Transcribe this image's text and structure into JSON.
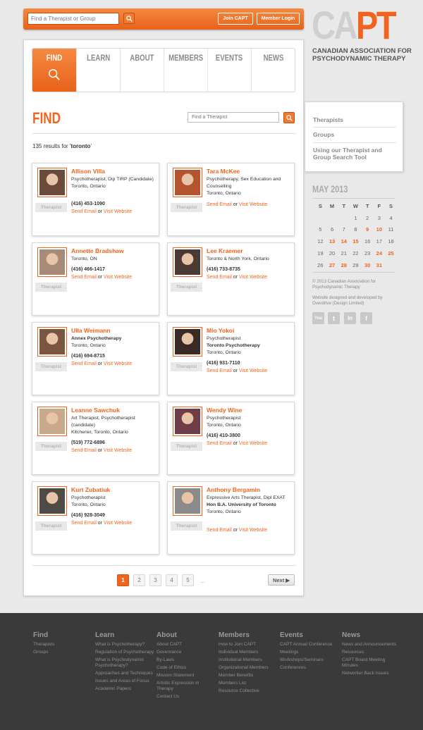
{
  "topbar": {
    "search_placeholder": "Find a Therapist or Group",
    "join_label": "Join CAPT",
    "login_label": "Member Login"
  },
  "logo": {
    "text_ca": "CA",
    "text_pt": "PT",
    "subtitle": "CANADIAN ASSOCIATION FOR PSYCHODYNAMIC THERAPY"
  },
  "nav": {
    "tabs": [
      {
        "label": "FIND"
      },
      {
        "label": "LEARN"
      },
      {
        "label": "ABOUT"
      },
      {
        "label": "MEMBERS"
      },
      {
        "label": "EVENTS"
      },
      {
        "label": "NEWS"
      }
    ]
  },
  "find": {
    "title": "FIND",
    "search_placeholder": "Find a Therapist",
    "results_prefix": "135 results for '",
    "results_query": "toronto",
    "results_suffix": "'"
  },
  "card_common": {
    "tag": "Therapist",
    "send_email": "Send Email",
    "or": " or ",
    "visit_website": "Visit Website"
  },
  "therapists": [
    {
      "name": "Allison Villa",
      "lines": [
        "Psychotherapist, Dip TIRP (Candidate)",
        "Toronto, Ontario"
      ],
      "phone": "(416) 453-1090",
      "photo_color": "#6b4a3a"
    },
    {
      "name": "Tara McKee",
      "lines": [
        "Psychotherapy, Sex Education and Counselling",
        "Toronto, Ontario"
      ],
      "phone": "",
      "photo_color": "#b5532e"
    },
    {
      "name": "Annette Bradshaw",
      "lines": [
        "Toronto, ON"
      ],
      "phone": "(416) 466-1417",
      "photo_color": "#a88a78"
    },
    {
      "name": "Lee Kraemer",
      "lines": [
        "Toronto & North York, Ontario"
      ],
      "phone": "(416) 733-8735",
      "photo_color": "#4b3a33"
    },
    {
      "name": "Ulla Weimann",
      "lines": [
        "Annex Psychotherapy",
        "Toronto, Ontario"
      ],
      "phone": "(416) 694-8715",
      "photo_color": "#7a5640"
    },
    {
      "name": "Mio Yokoi",
      "lines": [
        "Psychotherapist",
        "Toronto Psychotherapy",
        "Toronto, Ontario"
      ],
      "phone": "(416) 931-7110",
      "photo_color": "#3a2a26"
    },
    {
      "name": "Leanne Sawchuk",
      "lines": [
        "Art Therapist, Psychotherapist (candidate)",
        "Kitchener, Toronto, Ontario"
      ],
      "phone": "(519) 772-6896",
      "photo_color": "#c9a98c"
    },
    {
      "name": "Wendy Wine",
      "lines": [
        "Psychotherapist",
        "Toronto, Ontario"
      ],
      "phone": "(416) 410-3800",
      "photo_color": "#6e3d48"
    },
    {
      "name": "Kurt Zubatiuk",
      "lines": [
        "Psychotherapist",
        "Toronto, Ontario"
      ],
      "phone": "(416) 928-3049",
      "photo_color": "#4e4a44"
    },
    {
      "name": "Anthony Bergamin",
      "lines": [
        "Expressive Arts Therapist, Dipl EXAT",
        "Hon B.A. University of Toronto",
        "Toronto, Ontario"
      ],
      "phone": "",
      "photo_color": "#8a8a8a"
    }
  ],
  "pagination": {
    "pages": [
      "1",
      "2",
      "3",
      "4",
      "5"
    ],
    "ellipsis": "...",
    "next": "Next ▶"
  },
  "sidemenu": {
    "items": [
      "Therapists",
      "Groups",
      "Using our Therapist and Group Search Tool"
    ]
  },
  "calendar": {
    "title": "MAY 2013",
    "days": [
      "S",
      "M",
      "T",
      "W",
      "T",
      "F",
      "S"
    ],
    "weeks": [
      [
        "",
        "",
        "",
        "1",
        "2",
        "3",
        "4"
      ],
      [
        "5",
        "6",
        "7",
        "8",
        "9",
        "10",
        "11"
      ],
      [
        "12",
        "13",
        "14",
        "15",
        "16",
        "17",
        "18"
      ],
      [
        "19",
        "20",
        "21",
        "22",
        "23",
        "24",
        "25"
      ],
      [
        "26",
        "27",
        "28",
        "29",
        "30",
        "31",
        ""
      ]
    ],
    "highlighted": [
      "9",
      "10",
      "13",
      "14",
      "15",
      "24",
      "25",
      "27",
      "28",
      "30",
      "31"
    ]
  },
  "sidebar_footer": {
    "copyright": "© 2013 Canadian Association for Psychodynamic Therapy",
    "credit": "Website designed and developed by Overdrive (Design Limited)",
    "social": [
      "You",
      "t",
      "in",
      "f"
    ]
  },
  "footer": {
    "columns": [
      {
        "heading": "Find",
        "links": [
          "Therapists",
          "Groups"
        ]
      },
      {
        "heading": "Learn",
        "links": [
          "What is Psychotherapy?",
          "Regulation of Psychotherapy",
          "What is Psychodynamic Psychotherapy?",
          "Approaches and Techniques",
          "Issues and Areas of Focus",
          "Academic Papers"
        ]
      },
      {
        "heading": "About",
        "links": [
          "About CAPT",
          "Governance",
          "By-Laws",
          "Code of Ethics",
          "Mission Statement",
          "Artistic Expression in Therapy",
          "Contact Us"
        ]
      },
      {
        "heading": "Members",
        "links": [
          "How to Join CAPT",
          "Individual Members",
          "Institutional Members",
          "Organizational Members",
          "Member Benefits",
          "Members List",
          "Resource Collective"
        ]
      },
      {
        "heading": "Events",
        "links": [
          "CAPT Annual Conference",
          "Meetings",
          "Workshops/Seminars",
          "Conferences"
        ]
      },
      {
        "heading": "News",
        "links": [
          "News and Announcements",
          "Resources",
          "CAPT Board Meeting Minutes",
          "Networker Back Issues"
        ]
      }
    ]
  },
  "colors": {
    "accent": "#f0641e",
    "footer_bg": "#3a3a3a"
  }
}
